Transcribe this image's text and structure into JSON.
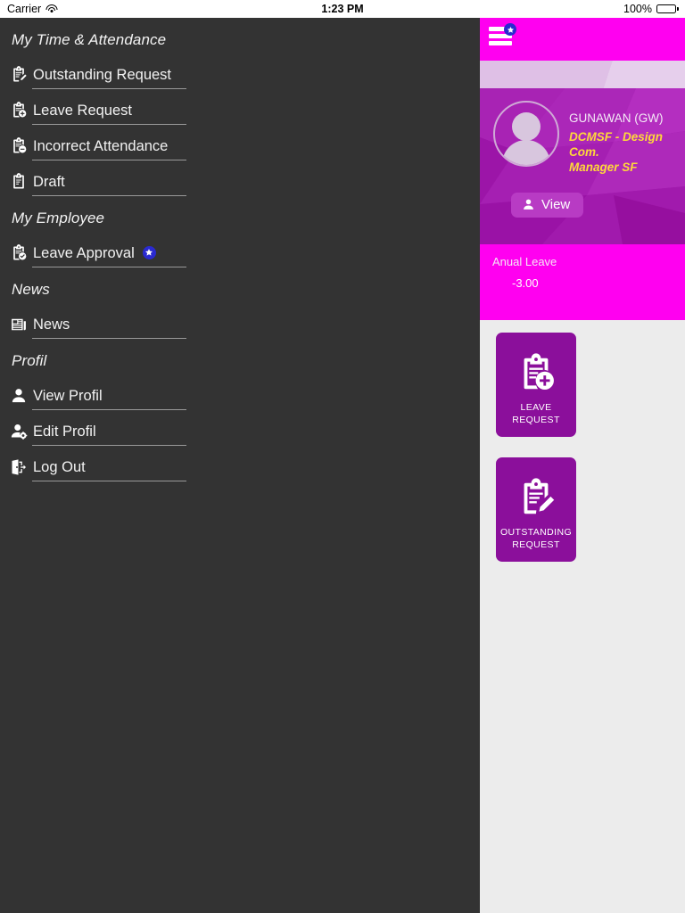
{
  "status_bar": {
    "carrier": "Carrier",
    "wifi_icon": "wifi-icon",
    "time": "1:23 PM",
    "battery_percent": "100%",
    "battery_icon": "battery-full-icon"
  },
  "sidebar": {
    "sections": [
      {
        "title": "My Time & Attendance",
        "items": [
          {
            "label": "Outstanding Request",
            "icon": "clipboard-pencil-icon",
            "badge": null
          },
          {
            "label": "Leave Request",
            "icon": "clipboard-plus-icon",
            "badge": null
          },
          {
            "label": "Incorrect Attendance",
            "icon": "clipboard-minus-icon",
            "badge": null
          },
          {
            "label": "Draft",
            "icon": "clipboard-icon",
            "badge": null
          }
        ]
      },
      {
        "title": "My Employee",
        "items": [
          {
            "label": "Leave Approval",
            "icon": "clipboard-check-icon",
            "badge": "star"
          }
        ]
      },
      {
        "title": "News",
        "items": [
          {
            "label": "News",
            "icon": "newspaper-icon",
            "badge": null
          }
        ]
      },
      {
        "title": "Profil",
        "items": [
          {
            "label": "View Profil",
            "icon": "person-icon",
            "badge": null
          },
          {
            "label": "Edit Profil",
            "icon": "person-gear-icon",
            "badge": null
          },
          {
            "label": "Log Out",
            "icon": "logout-door-icon",
            "badge": null
          }
        ]
      }
    ]
  },
  "right_panel": {
    "topbar": {
      "menu_icon": "hamburger-menu-icon",
      "badge_icon": "star-badge-icon",
      "background_color": "#ff00f0"
    },
    "profile": {
      "avatar_icon": "user-avatar-placeholder",
      "name": "GUNAWAN (GW)",
      "role_line1": "DCMSF - Design Com.",
      "role_line2": "Manager SF",
      "role_color": "#ffd83a",
      "view_button": {
        "label": "View",
        "icon": "person-icon"
      }
    },
    "leave_card": {
      "title": "Anual Leave",
      "value": "-3.00",
      "background_color": "#ff00f0"
    },
    "tiles": [
      {
        "icon": "clipboard-plus-icon",
        "label_line1": "LEAVE",
        "label_line2": "REQUEST",
        "color": "#8b0f9b"
      },
      {
        "icon": "clipboard-pencil-icon",
        "label_line1": "OUTSTANDING",
        "label_line2": "REQUEST",
        "color": "#8b0f9b"
      }
    ]
  }
}
